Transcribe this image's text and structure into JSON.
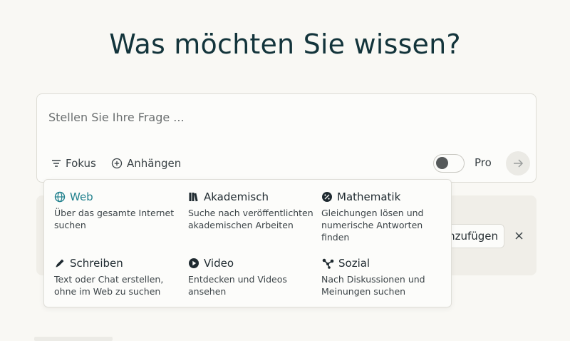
{
  "headline": "Was möchten Sie wissen?",
  "search": {
    "placeholder": "Stellen Sie Ihre Frage ...",
    "value": ""
  },
  "toolbar": {
    "focus_label": "Fokus",
    "attach_label": "Anhängen",
    "pro_label": "Pro",
    "pro_enabled": false
  },
  "card": {
    "add_label": "nzufügen"
  },
  "focus_menu": {
    "options": [
      {
        "label": "Web",
        "description": "Über das gesamte Internet suchen",
        "icon": "globe-icon",
        "selected": true
      },
      {
        "label": "Akademisch",
        "description": "Suche nach veröffentlichten akademischen Arbeiten",
        "icon": "books-icon",
        "selected": false
      },
      {
        "label": "Mathematik",
        "description": "Gleichungen lösen und numerische Antworten finden",
        "icon": "percent-badge-icon",
        "selected": false
      },
      {
        "label": "Schreiben",
        "description": "Text oder Chat erstellen, ohne im Web zu suchen",
        "icon": "pencil-icon",
        "selected": false
      },
      {
        "label": "Video",
        "description": "Entdecken und Videos ansehen",
        "icon": "play-circle-icon",
        "selected": false
      },
      {
        "label": "Sozial",
        "description": "Nach Diskussionen und Meinungen suchen",
        "icon": "network-icon",
        "selected": false
      }
    ]
  },
  "colors": {
    "accent": "#20808d",
    "background": "#f9f8f4",
    "headline": "#13343b"
  }
}
